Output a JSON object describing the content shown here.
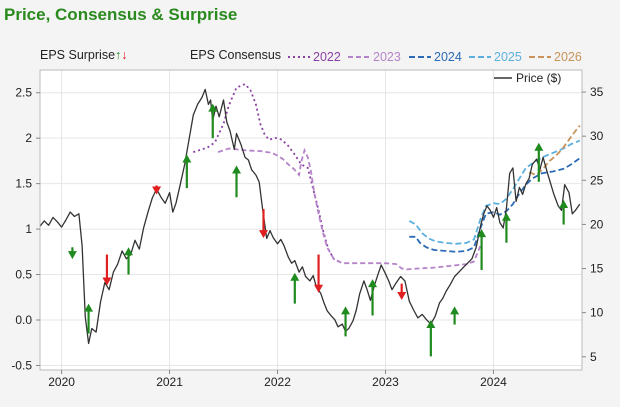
{
  "title": "Price, Consensus & Surprise",
  "legend": {
    "eps_surprise_label": "EPS Surprise",
    "eps_consensus_label": "EPS Consensus",
    "price_label": "Price ($)"
  },
  "colors": {
    "title": "#2a8a1e",
    "up_arrow": "#1f8b1f",
    "down_arrow": "#e02020",
    "price": "#333333",
    "c2022": "#8a3fa3",
    "c2023": "#b583c9",
    "c2024": "#2c6bb5",
    "c2025": "#5bb0de",
    "c2026": "#c8935a"
  },
  "chart_data": {
    "type": "line",
    "x_ticks": [
      "2020",
      "2021",
      "2022",
      "2023",
      "2024"
    ],
    "y_left_ticks": [
      "2.5",
      "2",
      "1.5",
      "1",
      "0.5",
      "0.0",
      "-0.5"
    ],
    "y_right_ticks": [
      "35",
      "30",
      "25",
      "20",
      "15",
      "10",
      "5"
    ],
    "y_left_range": [
      -0.55,
      2.75
    ],
    "y_right_range": [
      3.5,
      37.5
    ],
    "x_range": [
      2019.8,
      2024.82
    ],
    "price": {
      "name": "Price ($)",
      "points": [
        [
          2019.8,
          19.8
        ],
        [
          2019.84,
          20.4
        ],
        [
          2019.88,
          19.9
        ],
        [
          2019.92,
          20.8
        ],
        [
          2019.96,
          20.3
        ],
        [
          2020.0,
          19.7
        ],
        [
          2020.04,
          20.5
        ],
        [
          2020.08,
          21.4
        ],
        [
          2020.12,
          20.9
        ],
        [
          2020.16,
          21.2
        ],
        [
          2020.19,
          17.6
        ],
        [
          2020.22,
          9.5
        ],
        [
          2020.25,
          6.5
        ],
        [
          2020.28,
          8.2
        ],
        [
          2020.32,
          7.8
        ],
        [
          2020.36,
          11.2
        ],
        [
          2020.4,
          13.4
        ],
        [
          2020.44,
          12.6
        ],
        [
          2020.48,
          14.6
        ],
        [
          2020.52,
          15.5
        ],
        [
          2020.56,
          17.0
        ],
        [
          2020.6,
          16.1
        ],
        [
          2020.64,
          16.6
        ],
        [
          2020.68,
          18.2
        ],
        [
          2020.72,
          17.2
        ],
        [
          2020.76,
          19.6
        ],
        [
          2020.8,
          21.4
        ],
        [
          2020.84,
          23.0
        ],
        [
          2020.88,
          24.0
        ],
        [
          2020.92,
          23.1
        ],
        [
          2020.96,
          22.4
        ],
        [
          2021.0,
          23.6
        ],
        [
          2021.03,
          21.4
        ],
        [
          2021.06,
          22.4
        ],
        [
          2021.1,
          24.6
        ],
        [
          2021.14,
          26.8
        ],
        [
          2021.18,
          29.6
        ],
        [
          2021.22,
          32.4
        ],
        [
          2021.26,
          33.6
        ],
        [
          2021.3,
          34.4
        ],
        [
          2021.33,
          35.3
        ],
        [
          2021.36,
          33.6
        ],
        [
          2021.38,
          34.1
        ],
        [
          2021.4,
          31.8
        ],
        [
          2021.43,
          33.4
        ],
        [
          2021.46,
          32.2
        ],
        [
          2021.5,
          34.1
        ],
        [
          2021.53,
          31.6
        ],
        [
          2021.56,
          30.6
        ],
        [
          2021.6,
          28.5
        ],
        [
          2021.62,
          30.3
        ],
        [
          2021.66,
          29.1
        ],
        [
          2021.7,
          27.6
        ],
        [
          2021.73,
          27.3
        ],
        [
          2021.76,
          26.2
        ],
        [
          2021.8,
          25.6
        ],
        [
          2021.83,
          24.8
        ],
        [
          2021.86,
          21.9
        ],
        [
          2021.9,
          18.4
        ],
        [
          2021.93,
          19.3
        ],
        [
          2021.96,
          18.5
        ],
        [
          2022.0,
          17.8
        ],
        [
          2022.03,
          18.3
        ],
        [
          2022.06,
          17.6
        ],
        [
          2022.1,
          16.3
        ],
        [
          2022.13,
          15.6
        ],
        [
          2022.16,
          15.9
        ],
        [
          2022.2,
          14.6
        ],
        [
          2022.23,
          15.2
        ],
        [
          2022.26,
          14.1
        ],
        [
          2022.3,
          13.6
        ],
        [
          2022.33,
          14.2
        ],
        [
          2022.36,
          12.9
        ],
        [
          2022.4,
          12.2
        ],
        [
          2022.43,
          11.1
        ],
        [
          2022.46,
          10.2
        ],
        [
          2022.5,
          9.6
        ],
        [
          2022.53,
          9.2
        ],
        [
          2022.56,
          8.4
        ],
        [
          2022.6,
          8.7
        ],
        [
          2022.63,
          7.9
        ],
        [
          2022.66,
          8.2
        ],
        [
          2022.7,
          9.1
        ],
        [
          2022.73,
          10.3
        ],
        [
          2022.76,
          12.1
        ],
        [
          2022.8,
          13.6
        ],
        [
          2022.83,
          12.6
        ],
        [
          2022.86,
          11.4
        ],
        [
          2022.9,
          13.2
        ],
        [
          2022.93,
          14.3
        ],
        [
          2022.96,
          15.4
        ],
        [
          2023.0,
          14.4
        ],
        [
          2023.03,
          13.6
        ],
        [
          2023.06,
          12.6
        ],
        [
          2023.1,
          13.4
        ],
        [
          2023.14,
          14.1
        ],
        [
          2023.18,
          13.6
        ],
        [
          2023.22,
          11.3
        ],
        [
          2023.26,
          10.3
        ],
        [
          2023.3,
          9.4
        ],
        [
          2023.34,
          9.8
        ],
        [
          2023.38,
          9.2
        ],
        [
          2023.42,
          8.7
        ],
        [
          2023.46,
          9.6
        ],
        [
          2023.5,
          11.1
        ],
        [
          2023.53,
          11.6
        ],
        [
          2023.56,
          12.4
        ],
        [
          2023.6,
          13.2
        ],
        [
          2023.64,
          14.1
        ],
        [
          2023.68,
          14.6
        ],
        [
          2023.72,
          15.1
        ],
        [
          2023.76,
          15.6
        ],
        [
          2023.8,
          16.1
        ],
        [
          2023.84,
          17.4
        ],
        [
          2023.88,
          19.8
        ],
        [
          2023.91,
          21.2
        ],
        [
          2023.94,
          22.1
        ],
        [
          2023.97,
          21.6
        ],
        [
          2024.0,
          20.8
        ],
        [
          2024.03,
          21.9
        ],
        [
          2024.06,
          20.2
        ],
        [
          2024.09,
          19.6
        ],
        [
          2024.12,
          21.8
        ],
        [
          2024.15,
          25.8
        ],
        [
          2024.18,
          26.4
        ],
        [
          2024.21,
          22.6
        ],
        [
          2024.24,
          24.2
        ],
        [
          2024.27,
          23.4
        ],
        [
          2024.3,
          24.6
        ],
        [
          2024.33,
          25.2
        ],
        [
          2024.36,
          26.8
        ],
        [
          2024.4,
          27.4
        ],
        [
          2024.43,
          26.2
        ],
        [
          2024.46,
          27.6
        ],
        [
          2024.5,
          25.8
        ],
        [
          2024.53,
          24.6
        ],
        [
          2024.56,
          23.4
        ],
        [
          2024.6,
          22.1
        ],
        [
          2024.63,
          21.6
        ],
        [
          2024.66,
          24.5
        ],
        [
          2024.7,
          23.6
        ],
        [
          2024.73,
          21.2
        ],
        [
          2024.76,
          21.6
        ],
        [
          2024.8,
          22.3
        ]
      ]
    },
    "consensus": [
      {
        "name": "2022",
        "points": [
          [
            2021.22,
            28.2
          ],
          [
            2021.35,
            28.7
          ],
          [
            2021.42,
            29.3
          ],
          [
            2021.5,
            31.4
          ],
          [
            2021.55,
            33.5
          ],
          [
            2021.62,
            35.5
          ],
          [
            2021.7,
            35.9
          ],
          [
            2021.75,
            35.2
          ],
          [
            2021.8,
            33.6
          ],
          [
            2021.84,
            31.4
          ],
          [
            2021.88,
            30.2
          ],
          [
            2021.92,
            29.6
          ],
          [
            2021.98,
            29.8
          ],
          [
            2022.04,
            29.6
          ],
          [
            2022.1,
            28.9
          ],
          [
            2022.16,
            27.9
          ],
          [
            2022.22,
            26.8
          ],
          [
            2022.28,
            26.4
          ],
          [
            2022.33,
            24.0
          ],
          [
            2022.38,
            21.6
          ],
          [
            2022.42,
            19.4
          ],
          [
            2022.47,
            17.2
          ],
          [
            2022.52,
            16.1
          ],
          [
            2022.58,
            15.7
          ]
        ]
      },
      {
        "name": "2023",
        "points": [
          [
            2021.45,
            28.2
          ],
          [
            2021.55,
            28.6
          ],
          [
            2021.7,
            28.4
          ],
          [
            2021.85,
            28.3
          ],
          [
            2021.95,
            28.1
          ],
          [
            2022.0,
            27.8
          ],
          [
            2022.05,
            27.4
          ],
          [
            2022.1,
            26.8
          ],
          [
            2022.15,
            26.3
          ],
          [
            2022.2,
            25.6
          ],
          [
            2022.22,
            27.1
          ],
          [
            2022.25,
            28.4
          ],
          [
            2022.28,
            27.6
          ],
          [
            2022.31,
            26.0
          ],
          [
            2022.34,
            23.6
          ],
          [
            2022.38,
            21.2
          ],
          [
            2022.42,
            19.1
          ],
          [
            2022.46,
            17.4
          ],
          [
            2022.52,
            16.1
          ],
          [
            2022.6,
            15.6
          ],
          [
            2022.8,
            15.6
          ],
          [
            2023.0,
            15.6
          ],
          [
            2023.1,
            15.5
          ],
          [
            2023.15,
            15.0
          ],
          [
            2023.2,
            14.9
          ],
          [
            2023.3,
            15.0
          ],
          [
            2023.45,
            15.1
          ],
          [
            2023.6,
            15.3
          ],
          [
            2023.75,
            15.5
          ],
          [
            2023.82,
            15.8
          ],
          [
            2023.88,
            17.6
          ]
        ]
      },
      {
        "name": "2024",
        "points": [
          [
            2023.22,
            18.6
          ],
          [
            2023.28,
            18.6
          ],
          [
            2023.32,
            17.9
          ],
          [
            2023.38,
            17.4
          ],
          [
            2023.45,
            17.1
          ],
          [
            2023.55,
            17.0
          ],
          [
            2023.65,
            16.9
          ],
          [
            2023.75,
            17.0
          ],
          [
            2023.82,
            17.4
          ],
          [
            2023.88,
            19.6
          ],
          [
            2023.93,
            21.2
          ],
          [
            2024.0,
            21.4
          ],
          [
            2024.06,
            21.1
          ],
          [
            2024.12,
            21.5
          ],
          [
            2024.18,
            22.3
          ],
          [
            2024.24,
            23.5
          ],
          [
            2024.3,
            24.5
          ],
          [
            2024.36,
            25.2
          ],
          [
            2024.45,
            25.8
          ],
          [
            2024.55,
            26.0
          ],
          [
            2024.65,
            26.3
          ],
          [
            2024.72,
            26.8
          ],
          [
            2024.8,
            27.5
          ]
        ]
      },
      {
        "name": "2025",
        "points": [
          [
            2023.22,
            20.4
          ],
          [
            2023.28,
            20.0
          ],
          [
            2023.34,
            19.0
          ],
          [
            2023.4,
            18.4
          ],
          [
            2023.46,
            18.1
          ],
          [
            2023.55,
            17.9
          ],
          [
            2023.65,
            17.8
          ],
          [
            2023.75,
            17.9
          ],
          [
            2023.82,
            18.3
          ],
          [
            2023.88,
            20.6
          ],
          [
            2023.93,
            22.1
          ],
          [
            2024.0,
            22.4
          ],
          [
            2024.06,
            22.3
          ],
          [
            2024.12,
            22.9
          ],
          [
            2024.18,
            24.0
          ],
          [
            2024.24,
            25.2
          ],
          [
            2024.3,
            26.4
          ],
          [
            2024.36,
            26.9
          ],
          [
            2024.45,
            27.6
          ],
          [
            2024.55,
            28.1
          ],
          [
            2024.65,
            28.6
          ],
          [
            2024.72,
            29.1
          ],
          [
            2024.8,
            29.5
          ]
        ]
      },
      {
        "name": "2026",
        "points": [
          [
            2024.33,
            25.9
          ],
          [
            2024.4,
            25.6
          ],
          [
            2024.46,
            26.3
          ],
          [
            2024.52,
            27.2
          ],
          [
            2024.58,
            27.8
          ],
          [
            2024.64,
            28.6
          ],
          [
            2024.7,
            29.6
          ],
          [
            2024.76,
            30.6
          ],
          [
            2024.8,
            31.2
          ]
        ]
      }
    ],
    "surprises": [
      {
        "x": 2020.1,
        "from": 0.8,
        "to": 0.67,
        "dir": "up"
      },
      {
        "x": 2020.25,
        "from": -0.15,
        "to": 0.18,
        "dir": "up"
      },
      {
        "x": 2020.42,
        "from": 0.72,
        "to": 0.38,
        "dir": "down"
      },
      {
        "x": 2020.62,
        "from": 0.5,
        "to": 0.8,
        "dir": "up"
      },
      {
        "x": 2020.88,
        "from": 1.48,
        "to": 1.38,
        "dir": "down"
      },
      {
        "x": 2021.16,
        "from": 1.45,
        "to": 1.82,
        "dir": "up"
      },
      {
        "x": 2021.4,
        "from": 2.0,
        "to": 2.38,
        "dir": "up"
      },
      {
        "x": 2021.62,
        "from": 1.35,
        "to": 1.7,
        "dir": "up"
      },
      {
        "x": 2021.87,
        "from": 1.22,
        "to": 0.9,
        "dir": "down"
      },
      {
        "x": 2022.16,
        "from": 0.18,
        "to": 0.52,
        "dir": "up"
      },
      {
        "x": 2022.38,
        "from": 0.72,
        "to": 0.3,
        "dir": "down"
      },
      {
        "x": 2022.63,
        "from": -0.18,
        "to": 0.15,
        "dir": "up"
      },
      {
        "x": 2022.88,
        "from": 0.05,
        "to": 0.45,
        "dir": "up"
      },
      {
        "x": 2023.15,
        "from": 0.4,
        "to": 0.22,
        "dir": "down"
      },
      {
        "x": 2023.42,
        "from": -0.4,
        "to": 0.0,
        "dir": "up"
      },
      {
        "x": 2023.64,
        "from": -0.05,
        "to": 0.15,
        "dir": "up"
      },
      {
        "x": 2023.89,
        "from": 0.55,
        "to": 1.0,
        "dir": "up"
      },
      {
        "x": 2024.12,
        "from": 0.85,
        "to": 1.18,
        "dir": "up"
      },
      {
        "x": 2024.42,
        "from": 1.52,
        "to": 1.95,
        "dir": "up"
      },
      {
        "x": 2024.65,
        "from": 1.05,
        "to": 1.32,
        "dir": "up"
      }
    ]
  }
}
